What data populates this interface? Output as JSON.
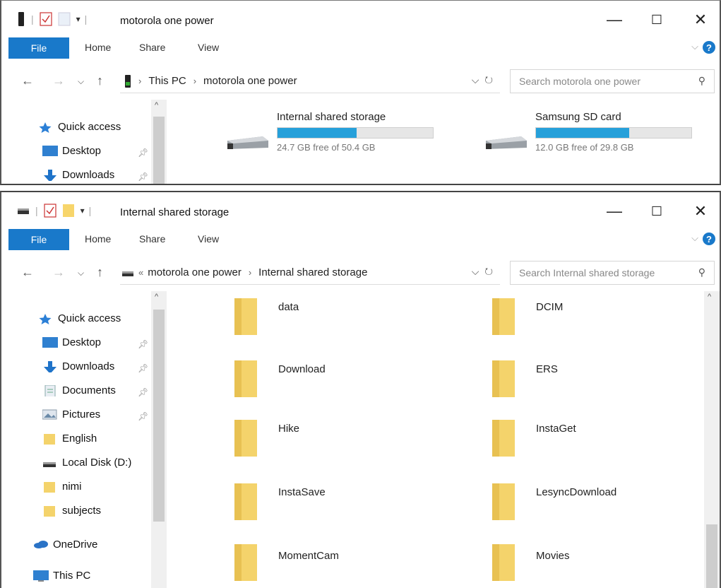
{
  "window1": {
    "title": "motorola one power",
    "ribbon": {
      "file": "File",
      "tabs": [
        "Home",
        "Share",
        "View"
      ]
    },
    "address": {
      "crumbs": [
        "This PC",
        "motorola one power"
      ]
    },
    "search_placeholder": "Search motorola one power",
    "sidebar": [
      {
        "label": "Quick access",
        "icon": "star-icon"
      },
      {
        "label": "Desktop",
        "icon": "desktop-icon",
        "pinned": true
      },
      {
        "label": "Downloads",
        "icon": "download-arrow-icon",
        "pinned": true
      }
    ],
    "drives": [
      {
        "name": "Internal shared storage",
        "free_text": "24.7 GB free of 50.4 GB",
        "used_fraction": 0.51
      },
      {
        "name": "Samsung SD card",
        "free_text": "12.0 GB free of 29.8 GB",
        "used_fraction": 0.6
      }
    ]
  },
  "window2": {
    "title": "Internal shared storage",
    "ribbon": {
      "file": "File",
      "tabs": [
        "Home",
        "Share",
        "View"
      ]
    },
    "address": {
      "overflow": "«",
      "crumbs": [
        "motorola one power",
        "Internal shared storage"
      ]
    },
    "search_placeholder": "Search Internal shared storage",
    "sidebar": [
      {
        "label": "Quick access",
        "icon": "star-icon"
      },
      {
        "label": "Desktop",
        "icon": "desktop-icon",
        "pinned": true
      },
      {
        "label": "Downloads",
        "icon": "download-arrow-icon",
        "pinned": true
      },
      {
        "label": "Documents",
        "icon": "document-icon",
        "pinned": true
      },
      {
        "label": "Pictures",
        "icon": "pictures-icon",
        "pinned": true
      },
      {
        "label": "English",
        "icon": "folder-icon"
      },
      {
        "label": "Local Disk (D:)",
        "icon": "drive-icon"
      },
      {
        "label": "nimi",
        "icon": "folder-icon"
      },
      {
        "label": "subjects",
        "icon": "folder-icon"
      },
      {
        "label": "OneDrive",
        "icon": "cloud-icon"
      },
      {
        "label": "This PC",
        "icon": "computer-icon"
      }
    ],
    "folders": [
      "data",
      "DCIM",
      "Download",
      "ERS",
      "Hike",
      "InstaGet",
      "InstaSave",
      "LesyncDownload",
      "MomentCam",
      "Movies"
    ]
  },
  "colors": {
    "accent": "#1979ca",
    "bar_fill": "#26a0da",
    "folder": "#f4d36b"
  }
}
